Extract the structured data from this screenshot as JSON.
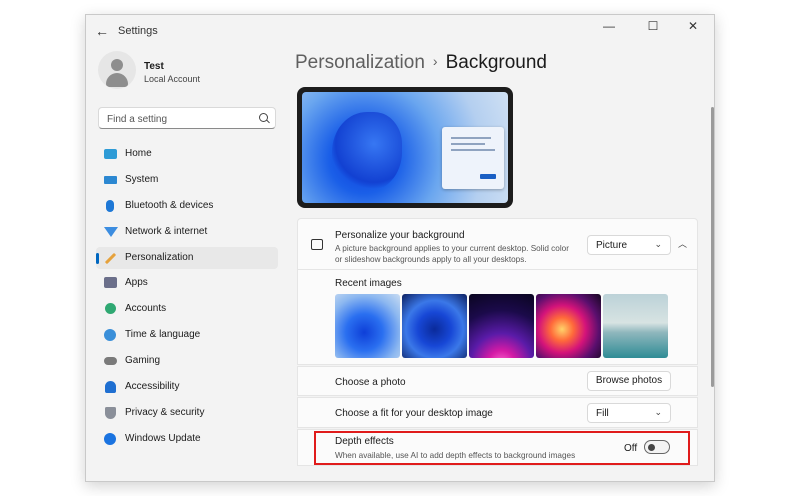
{
  "app": {
    "title": "Settings",
    "window_controls": {
      "minimize": "—",
      "maximize": "☐",
      "close": "✕"
    }
  },
  "user": {
    "name": "Test",
    "account_type": "Local Account"
  },
  "search": {
    "placeholder": "Find a setting"
  },
  "sidebar": {
    "items": [
      {
        "label": "Home",
        "icon": "home-icon"
      },
      {
        "label": "System",
        "icon": "system-icon"
      },
      {
        "label": "Bluetooth & devices",
        "icon": "bluetooth-icon"
      },
      {
        "label": "Network & internet",
        "icon": "wifi-icon"
      },
      {
        "label": "Personalization",
        "icon": "brush-icon",
        "selected": true
      },
      {
        "label": "Apps",
        "icon": "apps-icon"
      },
      {
        "label": "Accounts",
        "icon": "accounts-icon"
      },
      {
        "label": "Time & language",
        "icon": "globe-icon"
      },
      {
        "label": "Gaming",
        "icon": "controller-icon"
      },
      {
        "label": "Accessibility",
        "icon": "accessibility-icon"
      },
      {
        "label": "Privacy & security",
        "icon": "shield-icon"
      },
      {
        "label": "Windows Update",
        "icon": "update-icon"
      }
    ]
  },
  "breadcrumb": {
    "parent": "Personalization",
    "separator": "›",
    "current": "Background"
  },
  "personalize": {
    "title": "Personalize your background",
    "description": "A picture background applies to your current desktop. Solid color or slideshow backgrounds apply to all your desktops.",
    "dropdown_value": "Picture"
  },
  "recent": {
    "label": "Recent images"
  },
  "choose_photo": {
    "label": "Choose a photo",
    "button": "Browse photos"
  },
  "fit": {
    "label": "Choose a fit for your desktop image",
    "dropdown_value": "Fill"
  },
  "depth": {
    "title": "Depth effects",
    "description": "When available, use AI to add depth effects to background images",
    "state": "Off"
  },
  "colors": {
    "accent": "#0067c0",
    "highlight": "#e01b1b"
  }
}
